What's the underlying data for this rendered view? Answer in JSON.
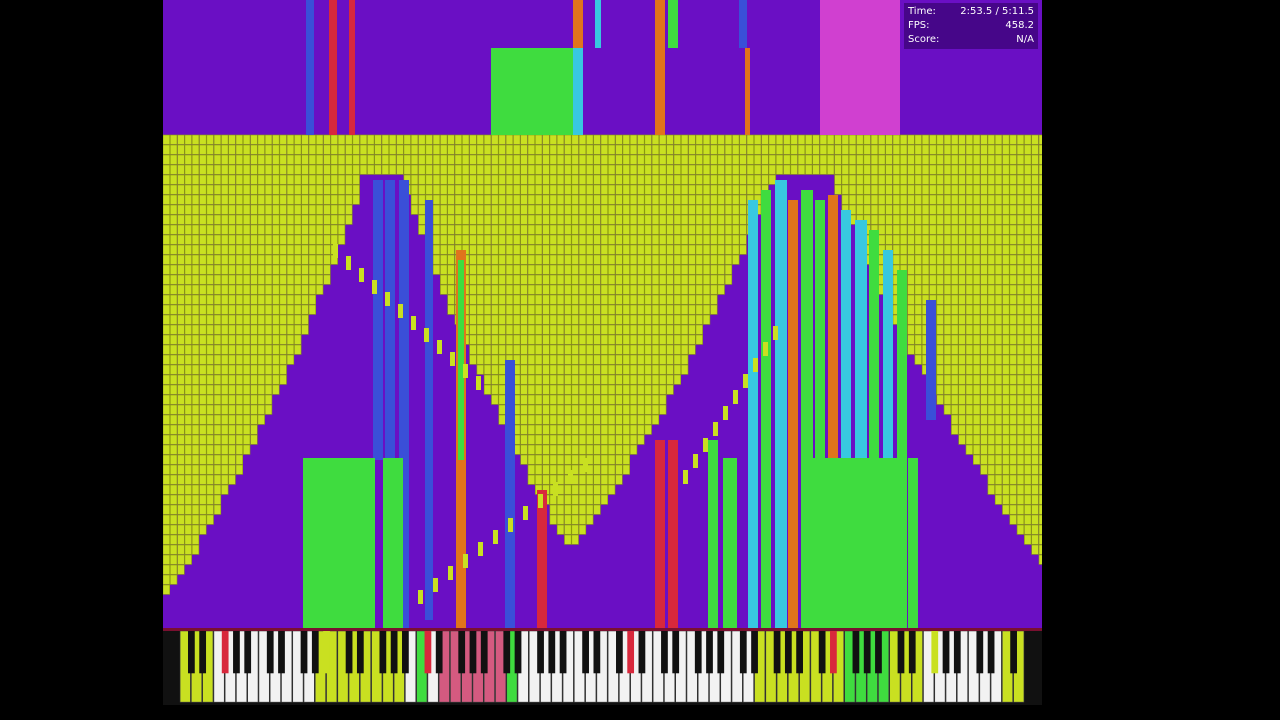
{
  "overlay": {
    "time_label": "Time:",
    "time_value": "2:53.5 / 5:11.5",
    "fps_label": "FPS:",
    "fps_value": "458.2",
    "score_label": "Score:",
    "score_value": "N/A"
  },
  "colors": {
    "background": "#6a0fc4",
    "note_yellow": "#c9e021",
    "note_green": "#3fdc3f",
    "note_blue": "#3a4fd8",
    "note_red": "#d8283c",
    "note_orange": "#e0741c",
    "note_cyan": "#38c8e0",
    "note_pink": "#d040d0",
    "white_key": "#f2f2f2",
    "black_key": "#111111"
  }
}
